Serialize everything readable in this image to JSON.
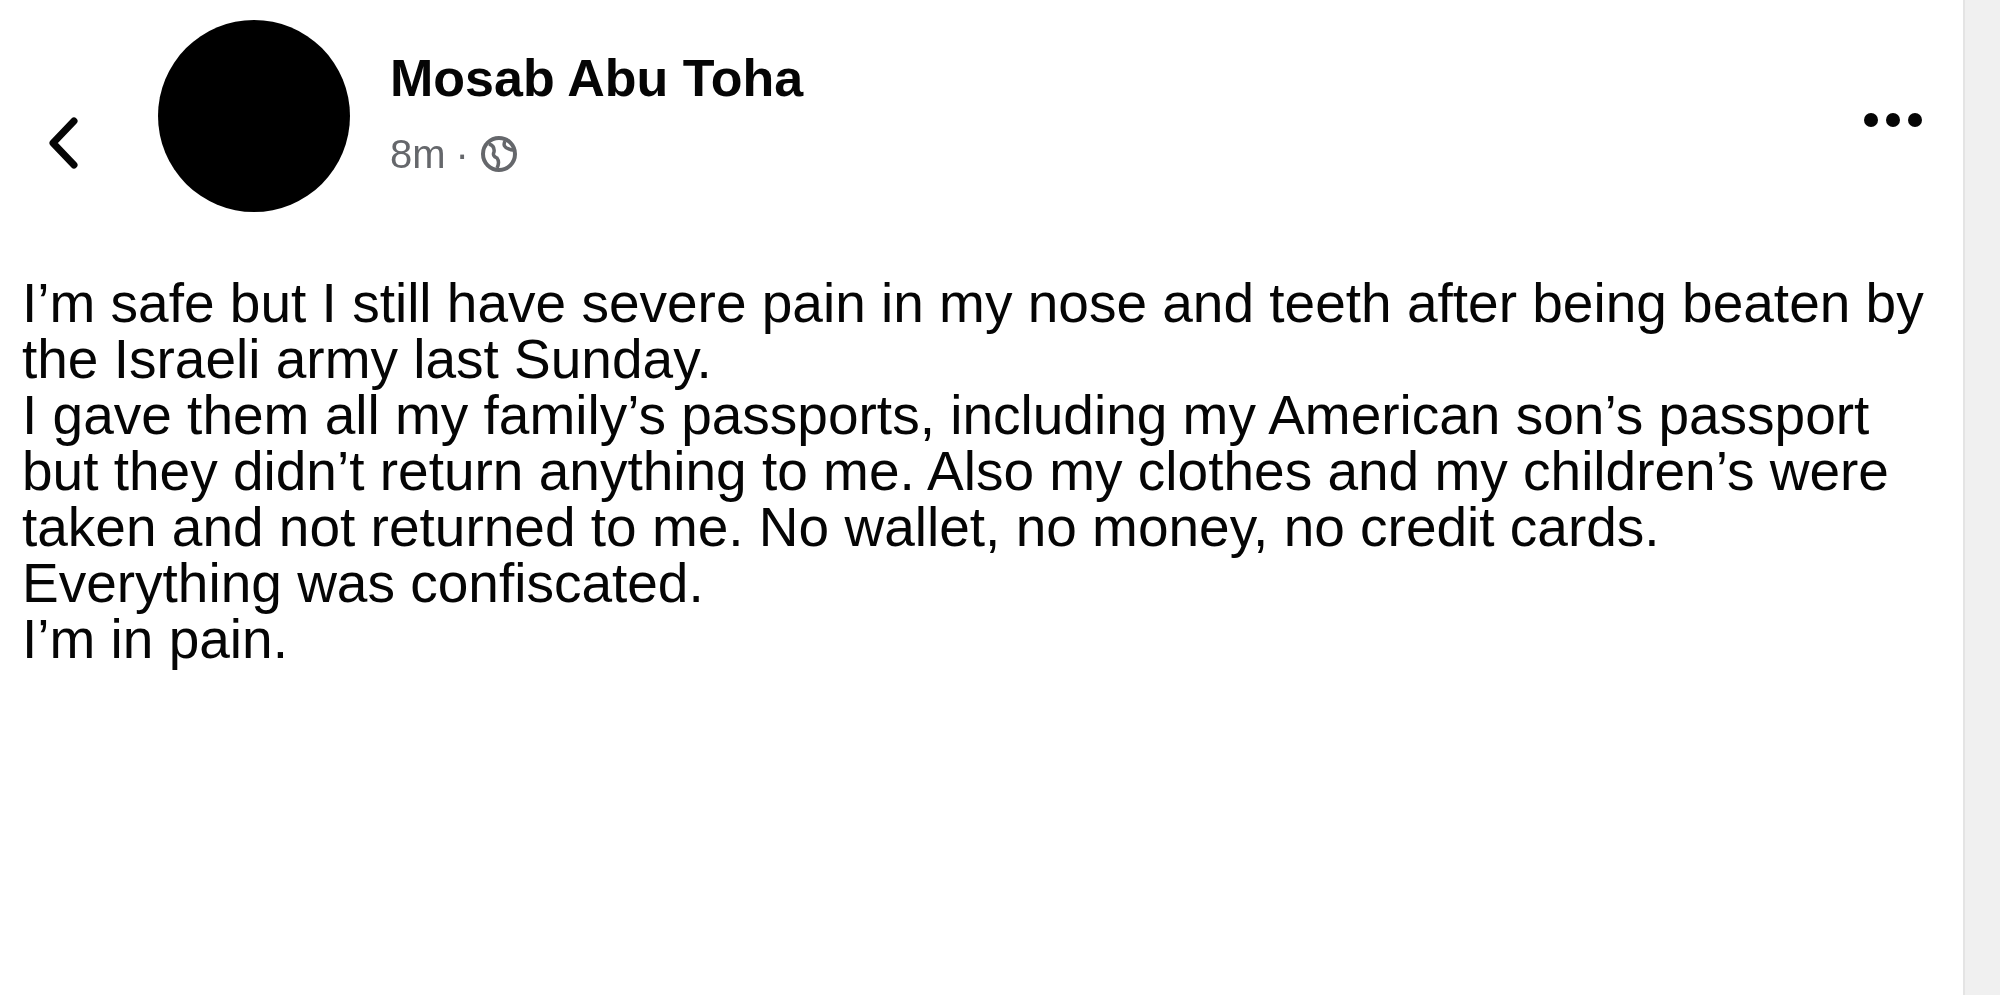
{
  "post": {
    "author": "Mosab Abu Toha",
    "time": "8m",
    "separator": "·",
    "paragraphs": [
      "I’m safe but I still have severe pain in my nose and teeth after being beaten by the Israeli army last Sunday.",
      "I gave them all my family’s passports, including my American son’s passport but they didn’t return anything to me. Also my clothes and my children’s were taken and not returned to me. No wallet, no money, no credit cards.",
      "Everything was confiscated.",
      "I’m in pain."
    ]
  }
}
